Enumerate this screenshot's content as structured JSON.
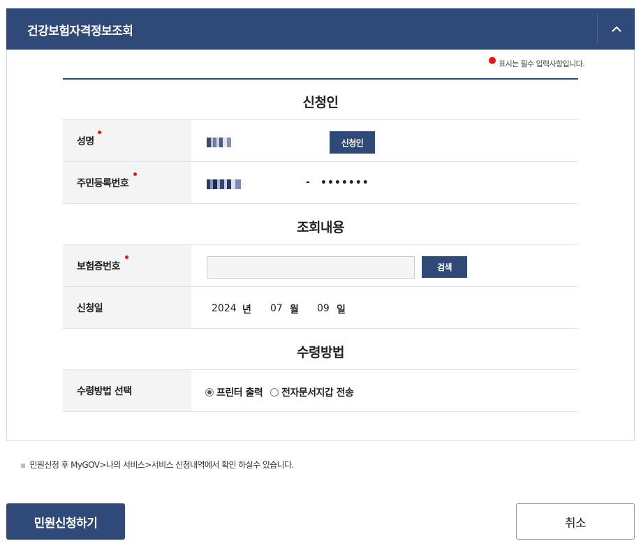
{
  "panel": {
    "title": "건강보험자격정보조회",
    "collapse_icon": "chevron-up-icon"
  },
  "required_note": "표시는 필수 입력사항입니다.",
  "sections": {
    "applicant": "신청인",
    "query": "조회내용",
    "receive": "수령방법"
  },
  "applicant": {
    "name_label": "성명",
    "name_button": "신청인",
    "rrn_label": "주민등록번호",
    "rrn_separator": "-",
    "rrn_back": "•••••••"
  },
  "query": {
    "card_label": "보험증번호",
    "card_value": "",
    "search_button": "검색",
    "date_label": "신청일",
    "year": "2024",
    "year_unit": "년",
    "month": "07",
    "month_unit": "월",
    "day": "09",
    "day_unit": "일"
  },
  "receive": {
    "label": "수령방법 선택",
    "options": [
      "프린터 출력",
      "전자문서지갑 전송"
    ],
    "selected": "프린터 출력"
  },
  "footnote": "민원신청 후 MyGOV>나의 서비스>서비스 신청내역에서 확인 하실수 있습니다.",
  "actions": {
    "submit": "민원신청하기",
    "cancel": "취소"
  },
  "colors": {
    "primary": "#2f4a78",
    "required": "#e11111",
    "label_bg": "#f4f4f4"
  }
}
